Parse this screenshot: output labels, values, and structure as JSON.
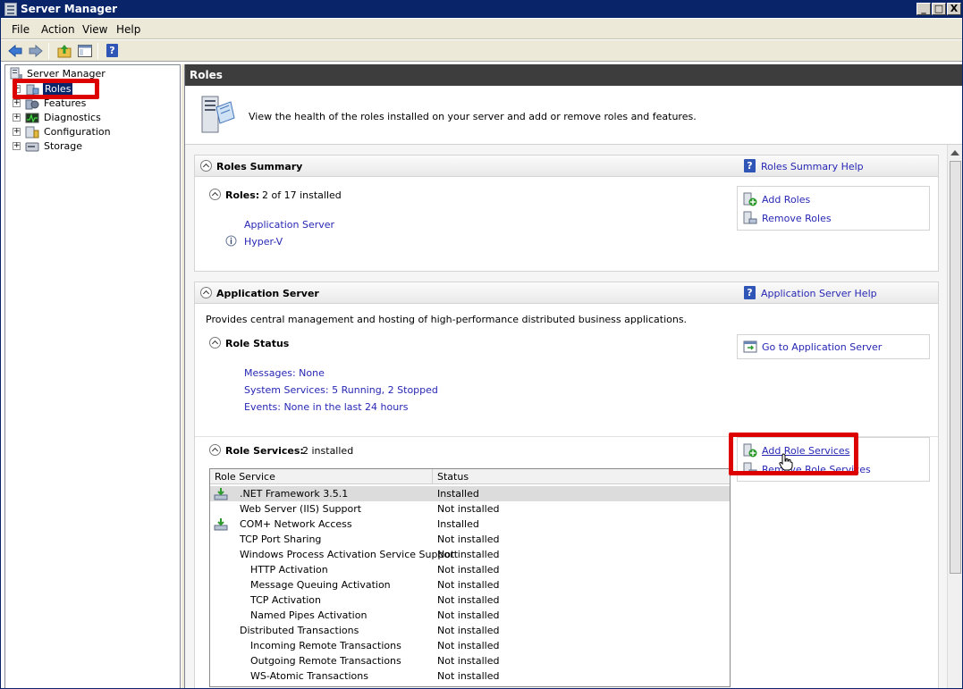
{
  "window": {
    "title": "Server Manager",
    "buttons": {
      "minimize": "_",
      "maximize": "□",
      "close": "X"
    }
  },
  "menu": [
    "File",
    "Action",
    "View",
    "Help"
  ],
  "toolbar": {
    "icons": [
      "back-arrow-icon",
      "forward-arrow-icon",
      "up-folder-icon",
      "show-hide-console-tree-icon",
      "help-icon"
    ],
    "help_glyph": "?"
  },
  "tree": {
    "root": "Server Manager",
    "items": [
      {
        "label": "Roles",
        "icon": "roles-icon",
        "selected": true
      },
      {
        "label": "Features",
        "icon": "features-icon"
      },
      {
        "label": "Diagnostics",
        "icon": "diagnostics-icon"
      },
      {
        "label": "Configuration",
        "icon": "configuration-icon"
      },
      {
        "label": "Storage",
        "icon": "storage-icon"
      }
    ],
    "expander": "+"
  },
  "right": {
    "header": "Roles",
    "intro": "View the health of the roles installed on your server and add or remove roles and features.",
    "roles_summary": {
      "title": "Roles Summary",
      "help_link": "Roles Summary Help",
      "roles_label": "Roles:",
      "roles_count": "2 of 17 installed",
      "roles": [
        "Application Server",
        "Hyper-V"
      ],
      "actions": [
        "Add Roles",
        "Remove Roles"
      ]
    },
    "app_server": {
      "title": "Application Server",
      "help_link": "Application Server Help",
      "description": "Provides central management and hosting of high-performance distributed business applications.",
      "role_status": {
        "title": "Role Status",
        "action": "Go to Application Server",
        "messages": "Messages: None",
        "services": "System Services: 5 Running, 2 Stopped",
        "events": "Events: None in the last 24 hours"
      },
      "role_services": {
        "title": "Role Services:",
        "count": "2 installed",
        "actions": [
          "Add Role Services",
          "Remove Role Services"
        ],
        "columns": [
          "Role Service",
          "Status"
        ],
        "rows": [
          {
            "name": ".NET Framework 3.5.1",
            "status": "Installed",
            "installed": true,
            "indent": 0,
            "selected": true
          },
          {
            "name": "Web Server (IIS) Support",
            "status": "Not installed",
            "installed": false,
            "indent": 0
          },
          {
            "name": "COM+ Network Access",
            "status": "Installed",
            "installed": true,
            "indent": 0
          },
          {
            "name": "TCP Port Sharing",
            "status": "Not installed",
            "installed": false,
            "indent": 0
          },
          {
            "name": "Windows Process Activation Service Support",
            "status": "Not installed",
            "installed": false,
            "indent": 0
          },
          {
            "name": "HTTP Activation",
            "status": "Not installed",
            "installed": false,
            "indent": 1
          },
          {
            "name": "Message Queuing Activation",
            "status": "Not installed",
            "installed": false,
            "indent": 1
          },
          {
            "name": "TCP Activation",
            "status": "Not installed",
            "installed": false,
            "indent": 1
          },
          {
            "name": "Named Pipes Activation",
            "status": "Not installed",
            "installed": false,
            "indent": 1
          },
          {
            "name": "Distributed Transactions",
            "status": "Not installed",
            "installed": false,
            "indent": 0
          },
          {
            "name": "Incoming Remote Transactions",
            "status": "Not installed",
            "installed": false,
            "indent": 1
          },
          {
            "name": "Outgoing Remote Transactions",
            "status": "Not installed",
            "installed": false,
            "indent": 1
          },
          {
            "name": "WS-Atomic Transactions",
            "status": "Not installed",
            "installed": false,
            "indent": 1
          }
        ]
      }
    }
  },
  "colors": {
    "title_bar": "#0a246a",
    "link": "#2727b4",
    "highlight_box": "#dd0000",
    "header_bar": "#3d3d3d"
  }
}
